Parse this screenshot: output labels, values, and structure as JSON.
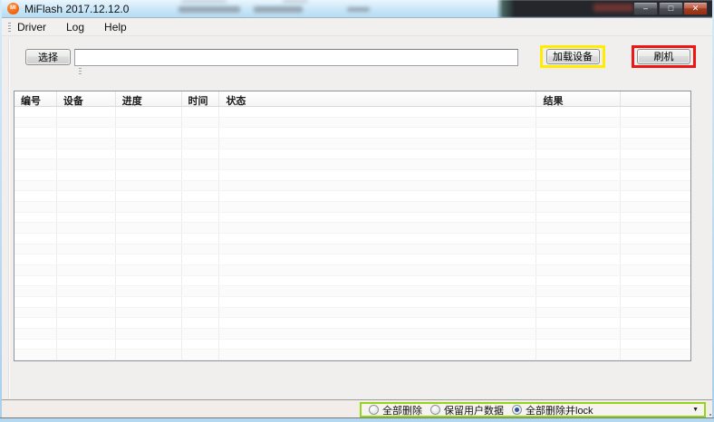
{
  "window": {
    "title": "MiFlash 2017.12.12.0",
    "controls": {
      "minimize": "–",
      "maximize": "□",
      "close": "✕"
    }
  },
  "menu": {
    "items": [
      {
        "label": "Driver"
      },
      {
        "label": "Log"
      },
      {
        "label": "Help"
      }
    ]
  },
  "toolbar": {
    "select_button": "选择",
    "path_input_value": "",
    "load_device_button": "加载设备",
    "flash_button": "刷机"
  },
  "table": {
    "columns": [
      "编号",
      "设备",
      "进度",
      "时间",
      "状态",
      "结果",
      ""
    ],
    "rows": [],
    "empty_row_count": 24
  },
  "footer": {
    "options": [
      {
        "label": "全部删除",
        "selected": false
      },
      {
        "label": "保留用户数据",
        "selected": false
      },
      {
        "label": "全部删除并lock",
        "selected": true
      }
    ],
    "dropdown_icon": "▼"
  },
  "annotations": {
    "load_device_highlight": "#ffec00",
    "flash_highlight": "#ee1515",
    "footer_highlight": "#93d41c"
  },
  "colors": {
    "titlebar_blue": "#c8e6f8",
    "brand_orange": "#f26208",
    "client_background": "#f0efee"
  }
}
